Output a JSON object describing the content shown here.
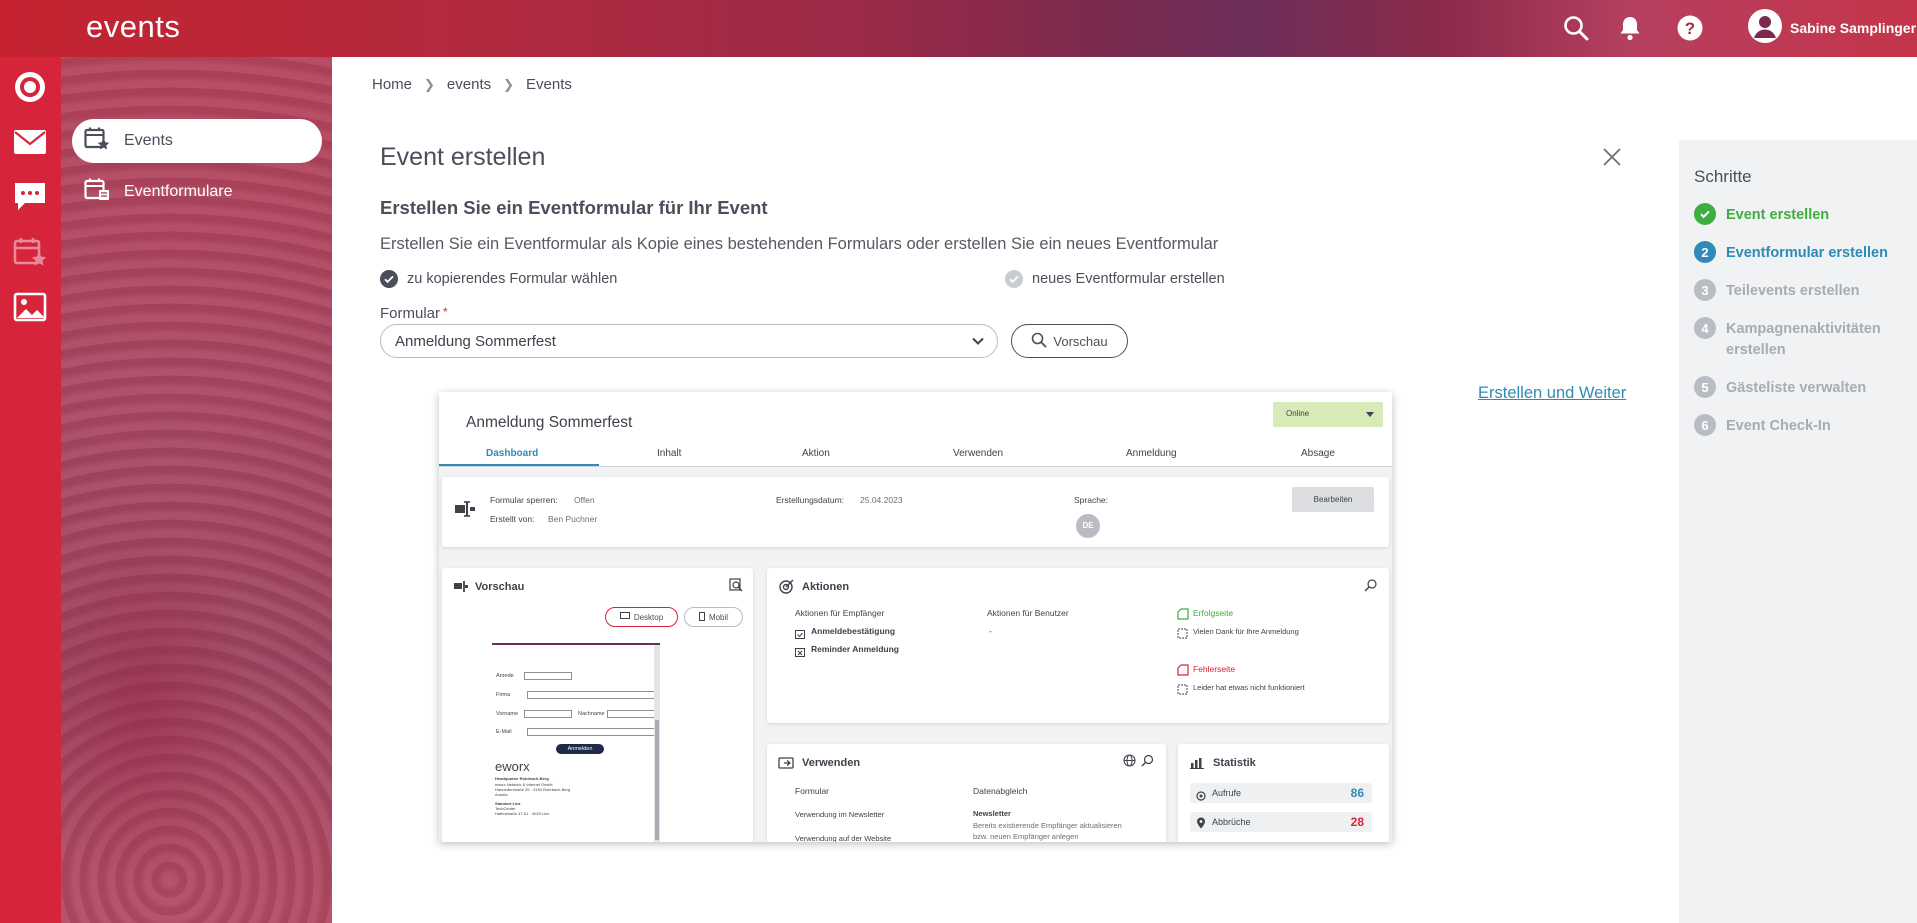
{
  "app": {
    "title": "events",
    "user_name": "Sabine Samplinger"
  },
  "topbar_icons": [
    "search-icon",
    "bell-icon",
    "help-icon",
    "user-avatar-icon"
  ],
  "rail_icons": [
    "logo-target-icon",
    "mail-icon",
    "chat-icon",
    "calendar-star-icon",
    "image-icon"
  ],
  "nav": {
    "items": [
      {
        "label": "Events",
        "active": true,
        "icon": "calendar-star-icon"
      },
      {
        "label": "Eventformulare",
        "active": false,
        "icon": "calendar-form-icon"
      }
    ]
  },
  "breadcrumb": [
    "Home",
    "events",
    "Events"
  ],
  "main": {
    "title": "Event erstellen",
    "subtitle": "Erstellen Sie ein Eventformular für Ihr Event",
    "description": "Erstellen Sie ein Eventformular als Kopie eines bestehenden Formulars oder erstellen Sie ein neues Eventformular",
    "option_copy": "zu kopierendes Formular wählen",
    "option_new": "neues Eventformular erstellen",
    "selected_option": "copy",
    "field_label": "Formular",
    "field_required_mark": "*",
    "select_value": "Anmeldung Sommerfest",
    "preview_button": "Vorschau",
    "create_next_link": "Erstellen und Weiter"
  },
  "preview": {
    "title": "Anmeldung Sommerfest",
    "status": "Online",
    "tabs": [
      "Dashboard",
      "Inhalt",
      "Aktion",
      "Verwenden",
      "Anmeldung",
      "Absage"
    ],
    "active_tab": "Dashboard",
    "info": {
      "lock_label": "Formular sperren:",
      "lock_value": "Offen",
      "created_by_label": "Erstellt von:",
      "created_by_value": "Ben Puchner",
      "date_label": "Erstellungsdatum:",
      "date_value": "25.04.2023",
      "lang_label": "Sprache:",
      "lang_value": "DE",
      "edit_button": "Bearbeiten"
    },
    "vorschau": {
      "title": "Vorschau",
      "desktop": "Desktop",
      "mobil": "Mobil",
      "form_fields": [
        "Anrede",
        "Firma",
        "Vorname",
        "Nachname",
        "E-Mail"
      ],
      "submit": "Anmelden",
      "brand": "eworx",
      "footer_lines": [
        "Headquarter Rohrbach-Berg",
        "eworx Network & Internet GmbH",
        "Hanriederstraße 25 · 4150 Rohrbach-Berg",
        "Austria",
        "Standort Linz",
        "TechCenter",
        "Hafenstraße 47-51 · 4020 Linz"
      ]
    },
    "aktionen": {
      "title": "Aktionen",
      "col_recipient": "Aktionen für Empfänger",
      "col_user": "Aktionen für Benutzer",
      "recipient_items": [
        "Anmeldebestätigung",
        "Reminder Anmeldung"
      ],
      "user_value": "-",
      "success_label": "Erfolgseite",
      "success_text": "Vielen Dank für Ihre Anmeldung",
      "error_label": "Fehlerseite",
      "error_text": "Leider hat etwas nicht funktioniert"
    },
    "verwenden": {
      "title": "Verwenden",
      "form_label": "Formular",
      "sync_label": "Datenabgleich",
      "newsletter_label": "Verwendung im Newsletter",
      "website_label": "Verwendung auf der Website",
      "newsletter_value": "Newsletter",
      "newsletter_note_1": "Bereits existierende Empfänger aktualisieren",
      "newsletter_note_2": "bzw. neuen Empfänger anlegen"
    },
    "statistik": {
      "title": "Statistik",
      "rows": [
        {
          "label": "Aufrufe",
          "value": "86",
          "color": "#2e8bb8"
        },
        {
          "label": "Abbrüche",
          "value": "28",
          "color": "#d6253a"
        }
      ]
    }
  },
  "steps": {
    "title": "Schritte",
    "items": [
      {
        "num": "✓",
        "label": "Event erstellen",
        "state": "done"
      },
      {
        "num": "2",
        "label": "Eventformular erstellen",
        "state": "current"
      },
      {
        "num": "3",
        "label": "Teilevents erstellen",
        "state": "pending"
      },
      {
        "num": "4",
        "label": "Kampagnenaktivitäten erstellen",
        "state": "pending"
      },
      {
        "num": "5",
        "label": "Gästeliste verwalten",
        "state": "pending"
      },
      {
        "num": "6",
        "label": "Event Check-In",
        "state": "pending"
      }
    ]
  },
  "colors": {
    "brand": "#d6253a",
    "accent": "#2e8bb8",
    "success": "#3eae3e"
  }
}
